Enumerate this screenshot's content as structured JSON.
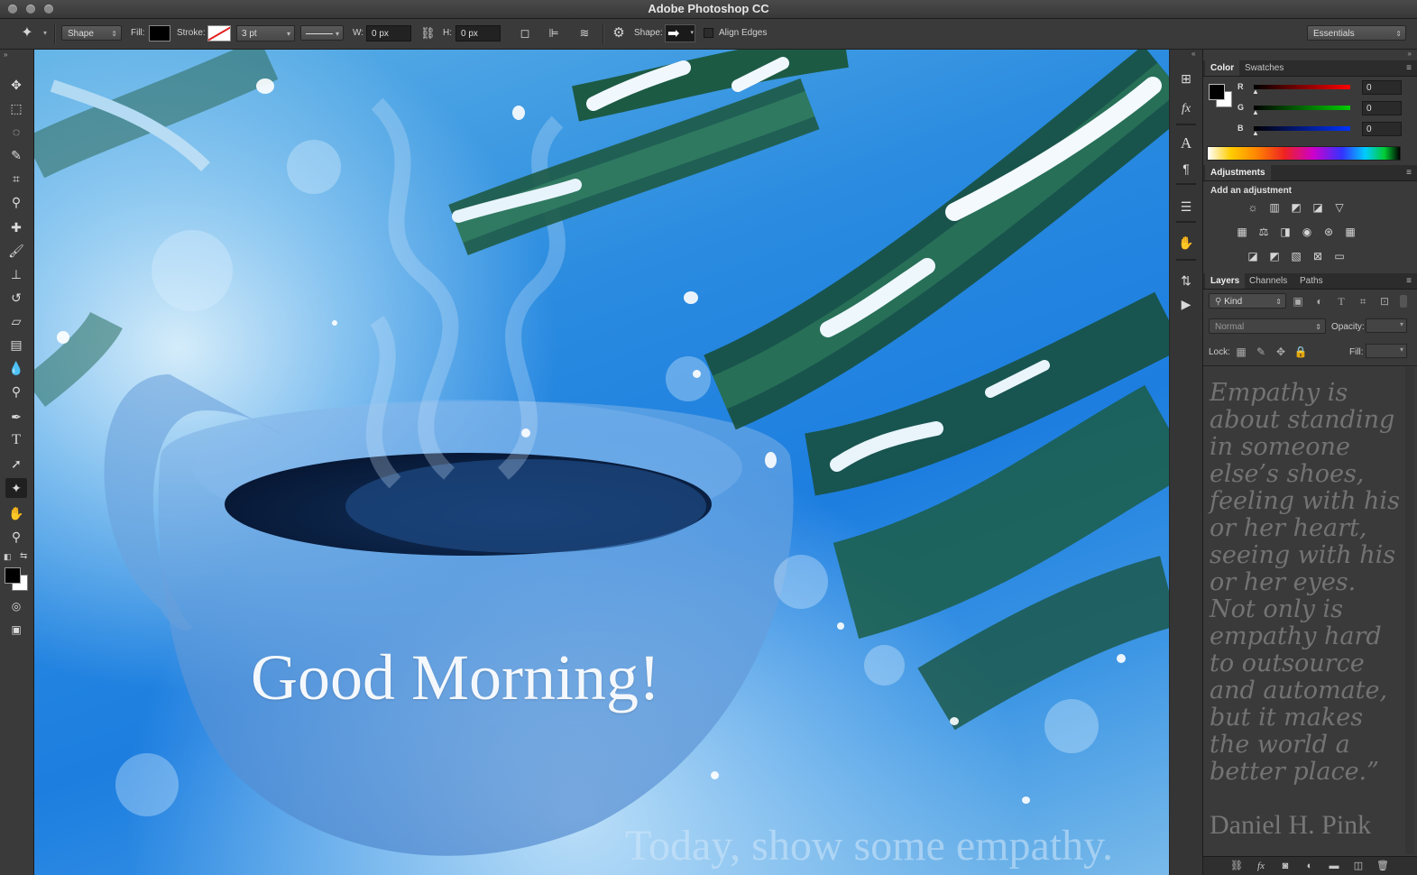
{
  "app": {
    "window_title": "Adobe Photoshop CC"
  },
  "options_bar": {
    "tool_icon": "custom-shape-tool-icon",
    "mode_value": "Shape",
    "fill_label": "Fill:",
    "stroke_label": "Stroke:",
    "stroke_width": "3 pt",
    "w_label": "W:",
    "w_value": "0 px",
    "h_label": "H:",
    "h_value": "0 px",
    "shape_label": "Shape:",
    "align_edges_label": "Align Edges",
    "align_edges_checked": false,
    "workspace": "Essentials"
  },
  "toolbar": {
    "tools": [
      "move-tool-icon",
      "marquee-tool-icon",
      "lasso-tool-icon",
      "quick-selection-tool-icon",
      "crop-tool-icon",
      "eyedropper-tool-icon",
      "healing-brush-tool-icon",
      "brush-tool-icon",
      "clone-stamp-tool-icon",
      "history-brush-tool-icon",
      "eraser-tool-icon",
      "gradient-tool-icon",
      "blur-tool-icon",
      "dodge-tool-icon",
      "pen-tool-icon",
      "type-tool-icon",
      "path-selection-tool-icon",
      "custom-shape-tool-icon",
      "hand-tool-icon",
      "zoom-tool-icon"
    ],
    "active_tool": "custom-shape-tool-icon",
    "foreground_color": "#000000",
    "background_color": "#ffffff"
  },
  "canvas": {
    "headline": "Good Morning!",
    "tagline": "Today, show some empathy."
  },
  "color_panel": {
    "tabs": [
      "Color",
      "Swatches"
    ],
    "active_tab": "Color",
    "r_label": "R",
    "r_value": "0",
    "g_label": "G",
    "g_value": "0",
    "b_label": "B",
    "b_value": "0"
  },
  "adjustments_panel": {
    "tab": "Adjustments",
    "heading": "Add an adjustment"
  },
  "layers_panel": {
    "tabs": [
      "Layers",
      "Channels",
      "Paths"
    ],
    "active_tab": "Layers",
    "filter_kind": "Kind",
    "blend_mode": "Normal",
    "opacity_label": "Opacity:",
    "lock_label": "Lock:",
    "fill_label": "Fill:",
    "quote": "Empathy is about standing in someone else’s shoes, feeling with his or her heart, seeing with his or her eyes. Not only is empathy hard to outsource and automate, but it makes the world a better place.”",
    "author": "Daniel H. Pink"
  }
}
